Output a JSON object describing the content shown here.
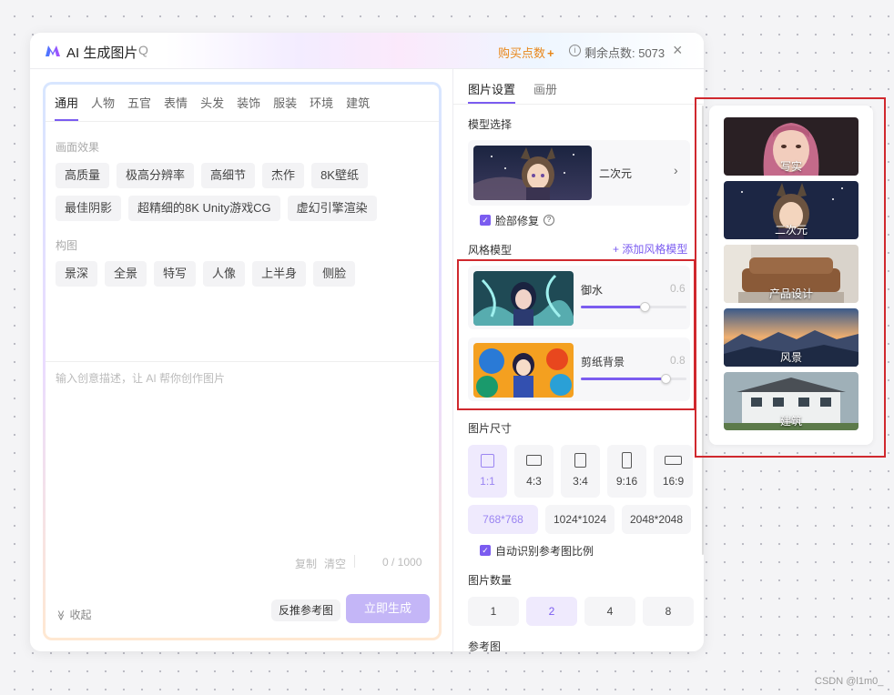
{
  "header": {
    "title": "AI 生成图片",
    "title_suffix": "Q",
    "buy_label": "购买点数",
    "buy_plus": "+",
    "points_label": "剩余点数: 5073",
    "close_glyph": "×",
    "info_glyph": "i"
  },
  "prompt_panel": {
    "tabs": [
      "通用",
      "人物",
      "五官",
      "表情",
      "头发",
      "装饰",
      "服装",
      "环境",
      "建筑"
    ],
    "active_tab": "通用",
    "sections": [
      {
        "label": "画面效果",
        "chips": [
          "高质量",
          "极高分辨率",
          "高细节",
          "杰作",
          "8K壁纸",
          "最佳阴影",
          "超精细的8K Unity游戏CG",
          "虚幻引擎渲染"
        ]
      },
      {
        "label": "构图",
        "chips": [
          "景深",
          "全景",
          "特写",
          "人像",
          "上半身",
          "侧脸"
        ]
      }
    ],
    "prompt_placeholder": "输入创意描述，让 AI 帮你创作图片",
    "copy_label": "复制",
    "clear_label": "清空",
    "char_count": "0 / 1000",
    "collapse_label": "收起",
    "collapse_glyph": "≫",
    "reverse_ref_label": "反推参考图",
    "generate_label": "立即生成"
  },
  "settings": {
    "tabs": [
      "图片设置",
      "画册"
    ],
    "model_section_label": "模型选择",
    "model_name": "二次元",
    "model_arrow": "›",
    "face_fix_label": "脸部修复",
    "face_fix_checked": true,
    "help_glyph": "?",
    "check_glyph": "✓",
    "style_section_label": "风格模型",
    "add_style_label": "+ 添加风格模型",
    "styles": [
      {
        "name": "御水",
        "value": "0.6",
        "level": 0.6
      },
      {
        "name": "剪纸背景",
        "value": "0.8",
        "level": 0.8
      }
    ],
    "size_section_label": "图片尺寸",
    "ratios": [
      "1:1",
      "4:3",
      "3:4",
      "9:16",
      "16:9"
    ],
    "active_ratio": "1:1",
    "sizes": [
      "768*768",
      "1024*1024",
      "2048*2048"
    ],
    "active_size": "768*768",
    "auto_ratio_label": "自动识别参考图比例",
    "qty_section_label": "图片数量",
    "quantities": [
      "1",
      "2",
      "4",
      "8"
    ],
    "active_quantity": "2",
    "ref_section_label": "参考图"
  },
  "model_popup": {
    "items": [
      "写实",
      "二次元",
      "产品设计",
      "风景",
      "建筑"
    ]
  },
  "watermark": "CSDN @l1m0_",
  "colors": {
    "accent": "#7b5cf0",
    "buy": "#e8871a",
    "highlight": "#d0282e"
  }
}
